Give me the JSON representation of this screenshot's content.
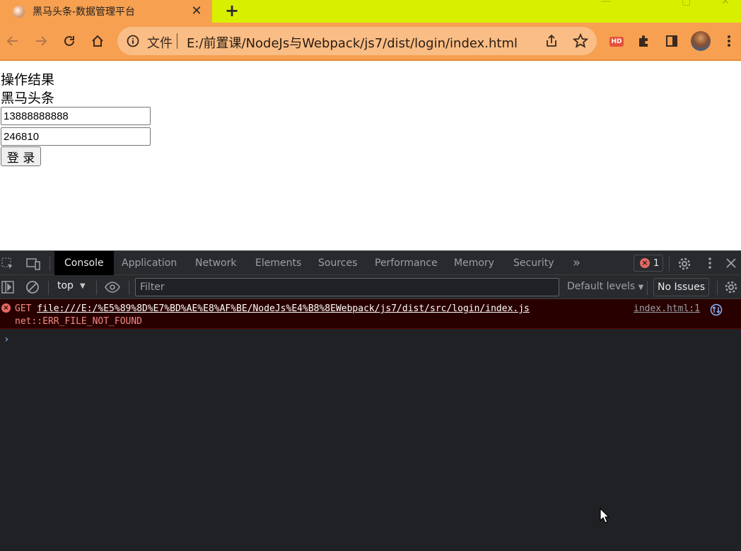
{
  "browser": {
    "tab_title": "黑马头条-数据管理平台",
    "tab_close": "✕",
    "new_tab": "+",
    "address_scheme": "文件",
    "address_url": "E:/前置课/NodeJs与Webpack/js7/dist/login/index.html",
    "extension_badge": "HD"
  },
  "page": {
    "heading1": "操作结果",
    "heading2": "黑马头条",
    "phone_value": "13888888888",
    "code_value": "246810",
    "login_label": "登 录"
  },
  "devtools": {
    "tabs": [
      "Console",
      "Application",
      "Network",
      "Elements",
      "Sources",
      "Performance",
      "Memory",
      "Security"
    ],
    "more_tabs": "»",
    "error_count": "1",
    "context": "top",
    "filter_placeholder": "Filter",
    "levels": "Default levels",
    "issues": "No Issues",
    "console": {
      "method": "GET",
      "url": "file:///E:/%E5%89%8D%E7%BD%AE%E8%AF%BE/NodeJs%E4%B8%8EWebpack/js7/dist/src/login/index.js",
      "error": "net::ERR_FILE_NOT_FOUND",
      "source": "index.html:1",
      "prompt": "›"
    }
  },
  "colors": {
    "tabstrip": "#d8f000",
    "toolbar": "#f7a051",
    "omnibox": "#f9bd85",
    "devtools_bg": "#202124",
    "error_bg": "#290000",
    "error_text": "#f28b82"
  }
}
